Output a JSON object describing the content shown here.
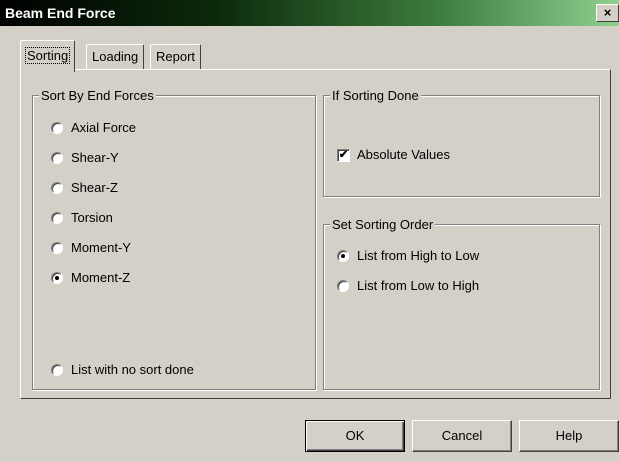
{
  "window": {
    "title": "Beam End Force",
    "close_glyph": "×"
  },
  "tabs": [
    {
      "label": "Sorting",
      "active": true
    },
    {
      "label": "Loading",
      "active": false
    },
    {
      "label": "Report",
      "active": false
    }
  ],
  "sort_by": {
    "title": "Sort By End Forces",
    "options": [
      {
        "label": "Axial Force",
        "checked": false
      },
      {
        "label": "Shear-Y",
        "checked": false
      },
      {
        "label": "Shear-Z",
        "checked": false
      },
      {
        "label": "Torsion",
        "checked": false
      },
      {
        "label": "Moment-Y",
        "checked": false
      },
      {
        "label": "Moment-Z",
        "checked": true
      }
    ],
    "no_sort": {
      "label": "List with no sort done",
      "checked": false
    }
  },
  "if_sorting": {
    "title": "If Sorting Done",
    "absolute": {
      "label": "Absolute Values",
      "checked": true,
      "check_glyph": "✔"
    }
  },
  "order": {
    "title": "Set Sorting Order",
    "options": [
      {
        "label": "List from High to Low",
        "checked": true
      },
      {
        "label": "List from Low to High",
        "checked": false
      }
    ]
  },
  "buttons": {
    "ok": "OK",
    "cancel": "Cancel",
    "help": "Help"
  }
}
